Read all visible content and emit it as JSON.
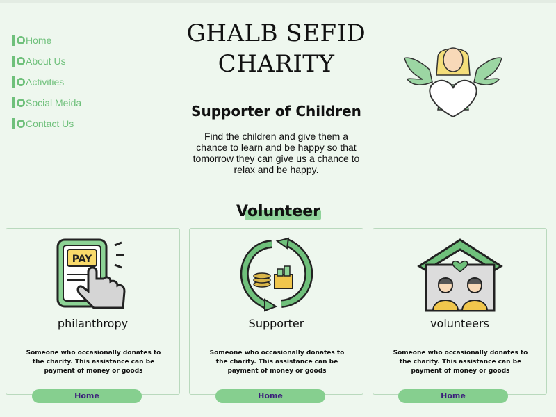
{
  "nav": {
    "items": [
      {
        "label": "Home",
        "icon": "home-icon"
      },
      {
        "label": "About Us",
        "icon": "about-icon"
      },
      {
        "label": "Activities",
        "icon": "activities-icon"
      },
      {
        "label": "Social Meida",
        "icon": "social-icon"
      },
      {
        "label": "Contact Us",
        "icon": "contact-icon"
      }
    ]
  },
  "header": {
    "title_line1": "GHALB SEFID",
    "title_line2": "CHARITY",
    "subtitle": "Supporter of Children",
    "description": "Find the children and give them a chance to learn and be happy so that tomorrow they can give us a chance to relax and be happy.",
    "logo_icon": "angel-heart-icon"
  },
  "section": {
    "title": "Volunteer"
  },
  "cards": [
    {
      "title": "philanthropy",
      "icon": "pay-hand-icon",
      "text": "Someone who occasionally donates to the charity. This assistance can be payment of money or goods",
      "button": "Home"
    },
    {
      "title": "Supporter",
      "icon": "money-cycle-icon",
      "text": "Someone who occasionally donates to the charity. This assistance can be payment of money or goods",
      "button": "Home"
    },
    {
      "title": "volunteers",
      "icon": "house-people-icon",
      "text": "Someone who occasionally donates to the charity. This assistance can be payment of money or goods",
      "button": "Home"
    }
  ],
  "colors": {
    "background": "#eef7ee",
    "accent": "#6fc07b",
    "button": "#86cf8f",
    "button_text": "#3b1e7a"
  }
}
